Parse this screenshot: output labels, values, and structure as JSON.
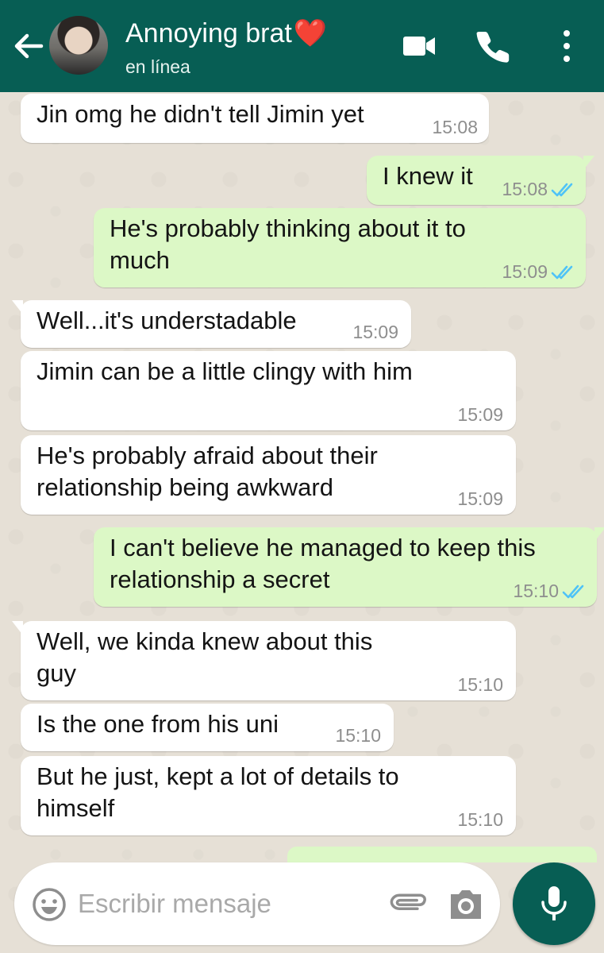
{
  "colors": {
    "header": "#075e54",
    "incoming_bubble": "#ffffff",
    "outgoing_bubble": "#dcf8c6",
    "read_ticks": "#4fc3f7",
    "mic_button": "#075e54"
  },
  "header": {
    "title": "Annoying brat",
    "heart": "❤️",
    "status": "en línea",
    "icons": [
      "back-arrow-icon",
      "video-call-icon",
      "phone-icon",
      "more-vert-icon"
    ]
  },
  "messages": [
    {
      "direction": "in",
      "text": "Jin omg he didn't tell Jimin yet",
      "time": "15:08"
    },
    {
      "direction": "out",
      "text": "I knew it",
      "time": "15:08",
      "status": "read"
    },
    {
      "direction": "out",
      "text": "He's probably thinking about it to much",
      "time": "15:09",
      "status": "read"
    },
    {
      "direction": "in",
      "text": "Well...it's understadable",
      "time": "15:09"
    },
    {
      "direction": "in",
      "text": "Jimin can be a little clingy with him",
      "time": "15:09"
    },
    {
      "direction": "in",
      "text": "He's probably afraid about their relationship being awkward",
      "time": "15:09"
    },
    {
      "direction": "out",
      "text": "I can't believe he managed to keep this relationship a secret",
      "time": "15:10",
      "status": "read"
    },
    {
      "direction": "in",
      "text": "Well, we kinda knew about this guy",
      "time": "15:10"
    },
    {
      "direction": "in",
      "text": "Is the one from his uni",
      "time": "15:10"
    },
    {
      "direction": "in",
      "text": "But he just, kept a lot of details to himself",
      "time": "15:10"
    }
  ],
  "composer": {
    "placeholder": "Escribir mensaje",
    "icons": [
      "emoji-icon",
      "attach-icon",
      "camera-icon",
      "mic-icon"
    ]
  }
}
